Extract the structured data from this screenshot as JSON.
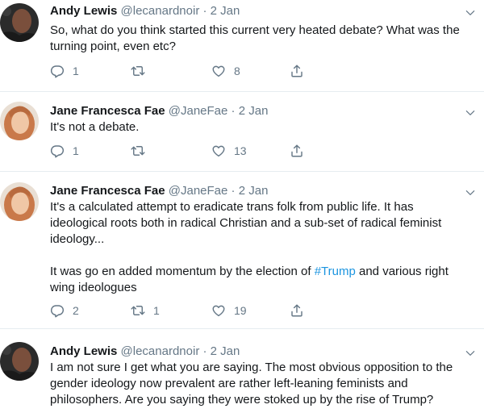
{
  "tweets": [
    {
      "author": "Andy Lewis",
      "handle": "@lecanardnoir",
      "separator": "·",
      "date": "2 Jan",
      "text": [
        "So, what do you think started this current very heated debate? What was the turning point, even etc?"
      ],
      "actions": {
        "replies": "1",
        "retweets": "",
        "likes": "8"
      }
    },
    {
      "author": "Jane Francesca Fae",
      "handle": "@JaneFae",
      "separator": "·",
      "date": "2 Jan",
      "text": [
        "It's not a debate."
      ],
      "actions": {
        "replies": "1",
        "retweets": "",
        "likes": "13"
      }
    },
    {
      "author": "Jane Francesca Fae",
      "handle": "@JaneFae",
      "separator": "·",
      "date": "2 Jan",
      "text": [
        "It's a calculated attempt to eradicate trans folk from public life. It has ideological roots both in radical Christian and a sub-set of radical feminist ideology...",
        "It was go en added momentum by the election of",
        "#Trump",
        "and various right wing ideologues"
      ],
      "actions": {
        "replies": "2",
        "retweets": "1",
        "likes": "19"
      }
    },
    {
      "author": "Andy Lewis",
      "handle": "@lecanardnoir",
      "separator": "·",
      "date": "2 Jan",
      "text": [
        "I am not sure I get what you are saying. The most obvious opposition to the gender ideology now prevalent are rather left-leaning feminists and philosophers. Are you saying they were stoked up by the rise of Trump?"
      ],
      "actions": null
    }
  ],
  "icons": {
    "reply": "reply-icon",
    "retweet": "retweet-icon",
    "like": "heart-icon",
    "share": "share-icon",
    "menu": "chevron-down-icon"
  },
  "colors": {
    "text": "#14171a",
    "secondary": "#657786",
    "link": "#1b95e0",
    "divider": "#e6ecf0"
  }
}
